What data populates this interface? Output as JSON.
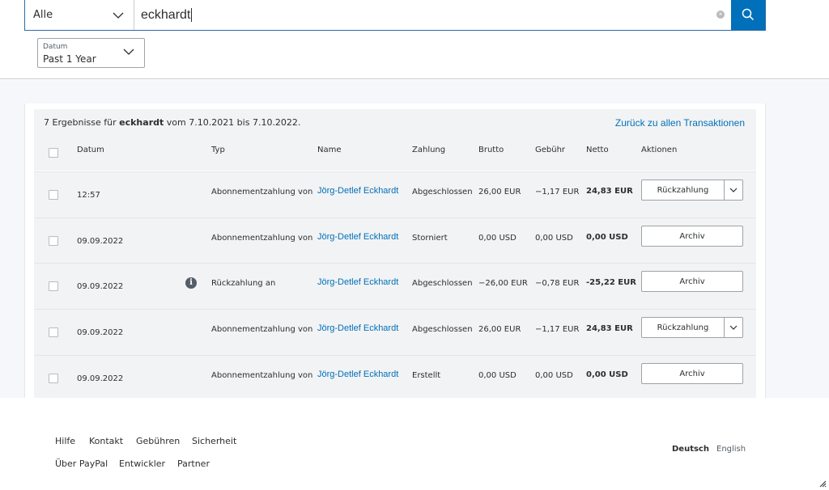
{
  "search": {
    "filter_value": "Alle",
    "query": "eckhardt"
  },
  "date_filter": {
    "label": "Datum",
    "value": "Past 1 Year"
  },
  "results": {
    "summary_prefix": "7 Ergebnisse für",
    "query": "eckhardt",
    "summary_suffix": "vom 7.10.2021 bis 7.10.2022.",
    "back_link": "Zurück zu allen Transaktionen"
  },
  "columns": {
    "datum": "Datum",
    "typ": "Typ",
    "name": "Name",
    "zahlung": "Zahlung",
    "brutto": "Brutto",
    "gebuehr": "Gebühr",
    "netto": "Netto",
    "aktionen": "Aktionen"
  },
  "rows": [
    {
      "date": "12:57",
      "type": "Abonnementzahlung von",
      "name": "Jörg-Detlef Eckhardt",
      "status": "Abgeschlossen",
      "gross": "26,00 EUR",
      "fee": "−1,17 EUR",
      "net": "24,83 EUR",
      "action": "Rückzahlung",
      "has_menu": true,
      "info": false
    },
    {
      "date": "09.09.2022",
      "type": "Abonnementzahlung von",
      "name": "Jörg-Detlef Eckhardt",
      "status": "Storniert",
      "gross": "0,00 USD",
      "fee": "0,00 USD",
      "net": "0,00 USD",
      "action": "Archiv",
      "has_menu": false,
      "info": false
    },
    {
      "date": "09.09.2022",
      "type": "Rückzahlung an",
      "name": "Jörg-Detlef Eckhardt",
      "status": "Abgeschlossen",
      "gross": "−26,00 EUR",
      "fee": "−0,78 EUR",
      "net": "-25,22 EUR",
      "action": "Archiv",
      "has_menu": false,
      "info": true
    },
    {
      "date": "09.09.2022",
      "type": "Abonnementzahlung von",
      "name": "Jörg-Detlef Eckhardt",
      "status": "Abgeschlossen",
      "gross": "26,00 EUR",
      "fee": "−1,17 EUR",
      "net": "24,83 EUR",
      "action": "Rückzahlung",
      "has_menu": true,
      "info": false
    },
    {
      "date": "09.09.2022",
      "type": "Abonnementzahlung von",
      "name": "Jörg-Detlef Eckhardt",
      "status": "Erstellt",
      "gross": "0,00 USD",
      "fee": "0,00 USD",
      "net": "0,00 USD",
      "action": "Archiv",
      "has_menu": false,
      "info": false
    }
  ],
  "info_glyph": "i",
  "footer": {
    "links_row1": [
      "Hilfe",
      "Kontakt",
      "Gebühren",
      "Sicherheit"
    ],
    "links_row2": [
      "Über PayPal",
      "Entwickler",
      "Partner"
    ],
    "languages": [
      "Deutsch",
      "English"
    ],
    "active_language": "Deutsch"
  },
  "colors": {
    "accent": "#0070ba",
    "row_bg": "#f2f3f4",
    "page_bg": "#f5f7fa"
  }
}
